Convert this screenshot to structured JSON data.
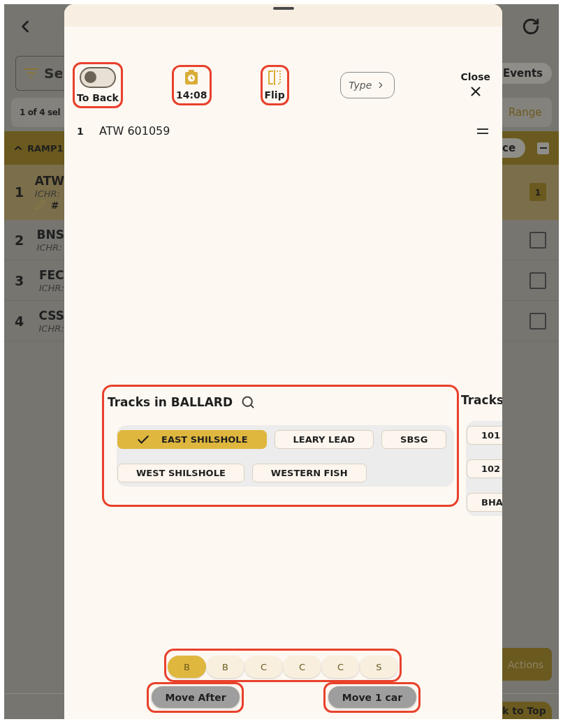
{
  "background": {
    "search_field": {
      "placeholder": "Se"
    },
    "events_button": "Events",
    "selection_summary": "1 of 4 sel",
    "range_button": "Range",
    "group": {
      "name": "RAMP1",
      "expanded": true,
      "button": "ce",
      "indeterminate": true
    },
    "rows": [
      {
        "number": "1",
        "title": "ATW",
        "subtitle": "ICHR:",
        "note": "#",
        "selected": true,
        "badge": "1"
      },
      {
        "number": "2",
        "title": "BNS",
        "subtitle": "ICHR:",
        "selected": false
      },
      {
        "number": "3",
        "title": "FEC",
        "subtitle": "ICHR:",
        "selected": false
      },
      {
        "number": "4",
        "title": "CSS",
        "subtitle": "ICHR:",
        "selected": false
      }
    ],
    "actions_button": "Actions",
    "back_to_top_button": "k to Top"
  },
  "sheet": {
    "tools": [
      {
        "kind": "toggle",
        "label": "To Back",
        "on": false,
        "highlighted": true
      },
      {
        "kind": "timer",
        "label": "14:08",
        "highlighted": true
      },
      {
        "kind": "flip",
        "label": "Flip",
        "highlighted": true
      },
      {
        "kind": "type",
        "label": "Type",
        "highlighted": false
      }
    ],
    "close": "Close",
    "cars": [
      {
        "index": "1",
        "name": "ATW 601059"
      }
    ],
    "track_groups": [
      {
        "title": "Tracks in BALLARD",
        "search": true,
        "highlighted": true,
        "tracks": [
          {
            "label": "EAST SHILSHOLE",
            "selected": true
          },
          {
            "label": "LEARY LEAD",
            "selected": false
          },
          {
            "label": "SBSG",
            "selected": false
          },
          {
            "label": "WEST SHILSHOLE",
            "selected": false
          },
          {
            "label": "WESTERN FISH",
            "selected": false
          }
        ]
      },
      {
        "title": "Tracks",
        "search": false,
        "highlighted": false,
        "tracks": [
          {
            "label": "101",
            "selected": false
          },
          {
            "label": "102",
            "selected": false
          },
          {
            "label": "BHA",
            "selected": false
          }
        ]
      }
    ],
    "car_types": {
      "highlighted": true,
      "items": [
        {
          "label": "B",
          "selected": true
        },
        {
          "label": "B",
          "selected": false
        },
        {
          "label": "C",
          "selected": false
        },
        {
          "label": "C",
          "selected": false
        },
        {
          "label": "C",
          "selected": false
        },
        {
          "label": "S",
          "selected": false
        }
      ]
    },
    "buttons": [
      {
        "label": "Move After",
        "highlighted": true
      },
      {
        "label": "Move 1 car",
        "highlighted": true
      }
    ]
  }
}
